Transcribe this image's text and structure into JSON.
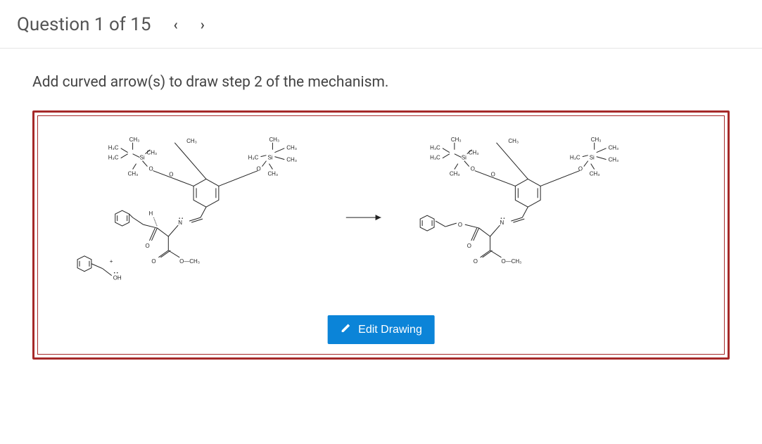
{
  "header": {
    "counter": "Question 1 of 15"
  },
  "prompt": "Add curved arrow(s) to draw step 2 of the mechanism.",
  "button": {
    "edit": "Edit Drawing"
  },
  "chem": {
    "labels": {
      "ch3": "CH₃",
      "h3c": "H₃C",
      "och3": "O—CH₃",
      "oh": "OH",
      "h": "H",
      "plus": "+",
      "o": "O",
      "n": "N",
      "si": "Si"
    }
  }
}
